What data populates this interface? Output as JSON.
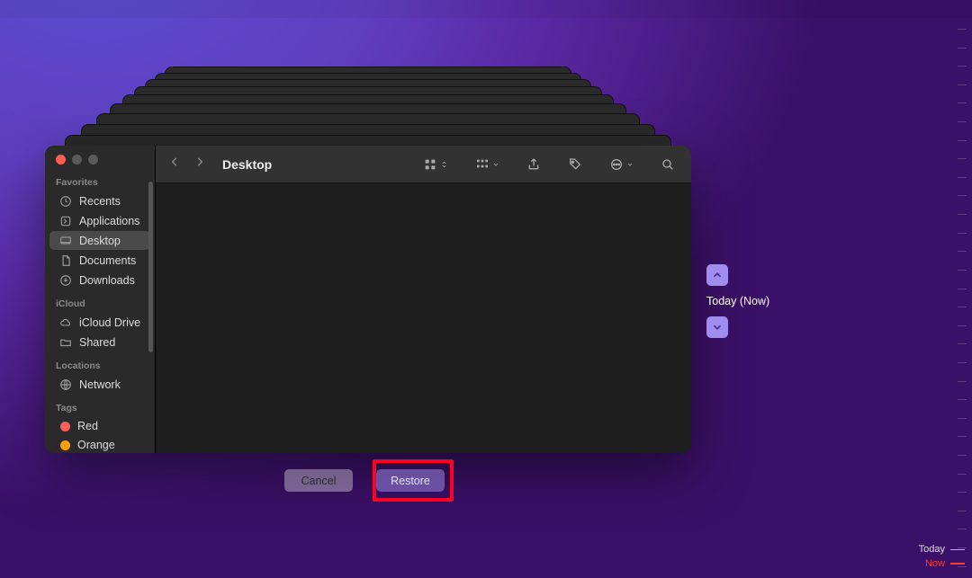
{
  "window": {
    "title": "Desktop"
  },
  "sidebar": {
    "sections": {
      "favorites": {
        "label": "Favorites",
        "items": [
          {
            "label": "Recents"
          },
          {
            "label": "Applications"
          },
          {
            "label": "Desktop"
          },
          {
            "label": "Documents"
          },
          {
            "label": "Downloads"
          }
        ]
      },
      "icloud": {
        "label": "iCloud",
        "items": [
          {
            "label": "iCloud Drive"
          },
          {
            "label": "Shared"
          }
        ]
      },
      "locations": {
        "label": "Locations",
        "items": [
          {
            "label": "Network"
          }
        ]
      },
      "tags": {
        "label": "Tags",
        "items": [
          {
            "label": "Red",
            "color": "#ff5f57"
          },
          {
            "label": "Orange",
            "color": "#ff9f0a"
          }
        ]
      }
    }
  },
  "timeline": {
    "current_label": "Today (Now)"
  },
  "buttons": {
    "cancel": "Cancel",
    "restore": "Restore"
  },
  "corner": {
    "today": "Today",
    "now": "Now"
  }
}
